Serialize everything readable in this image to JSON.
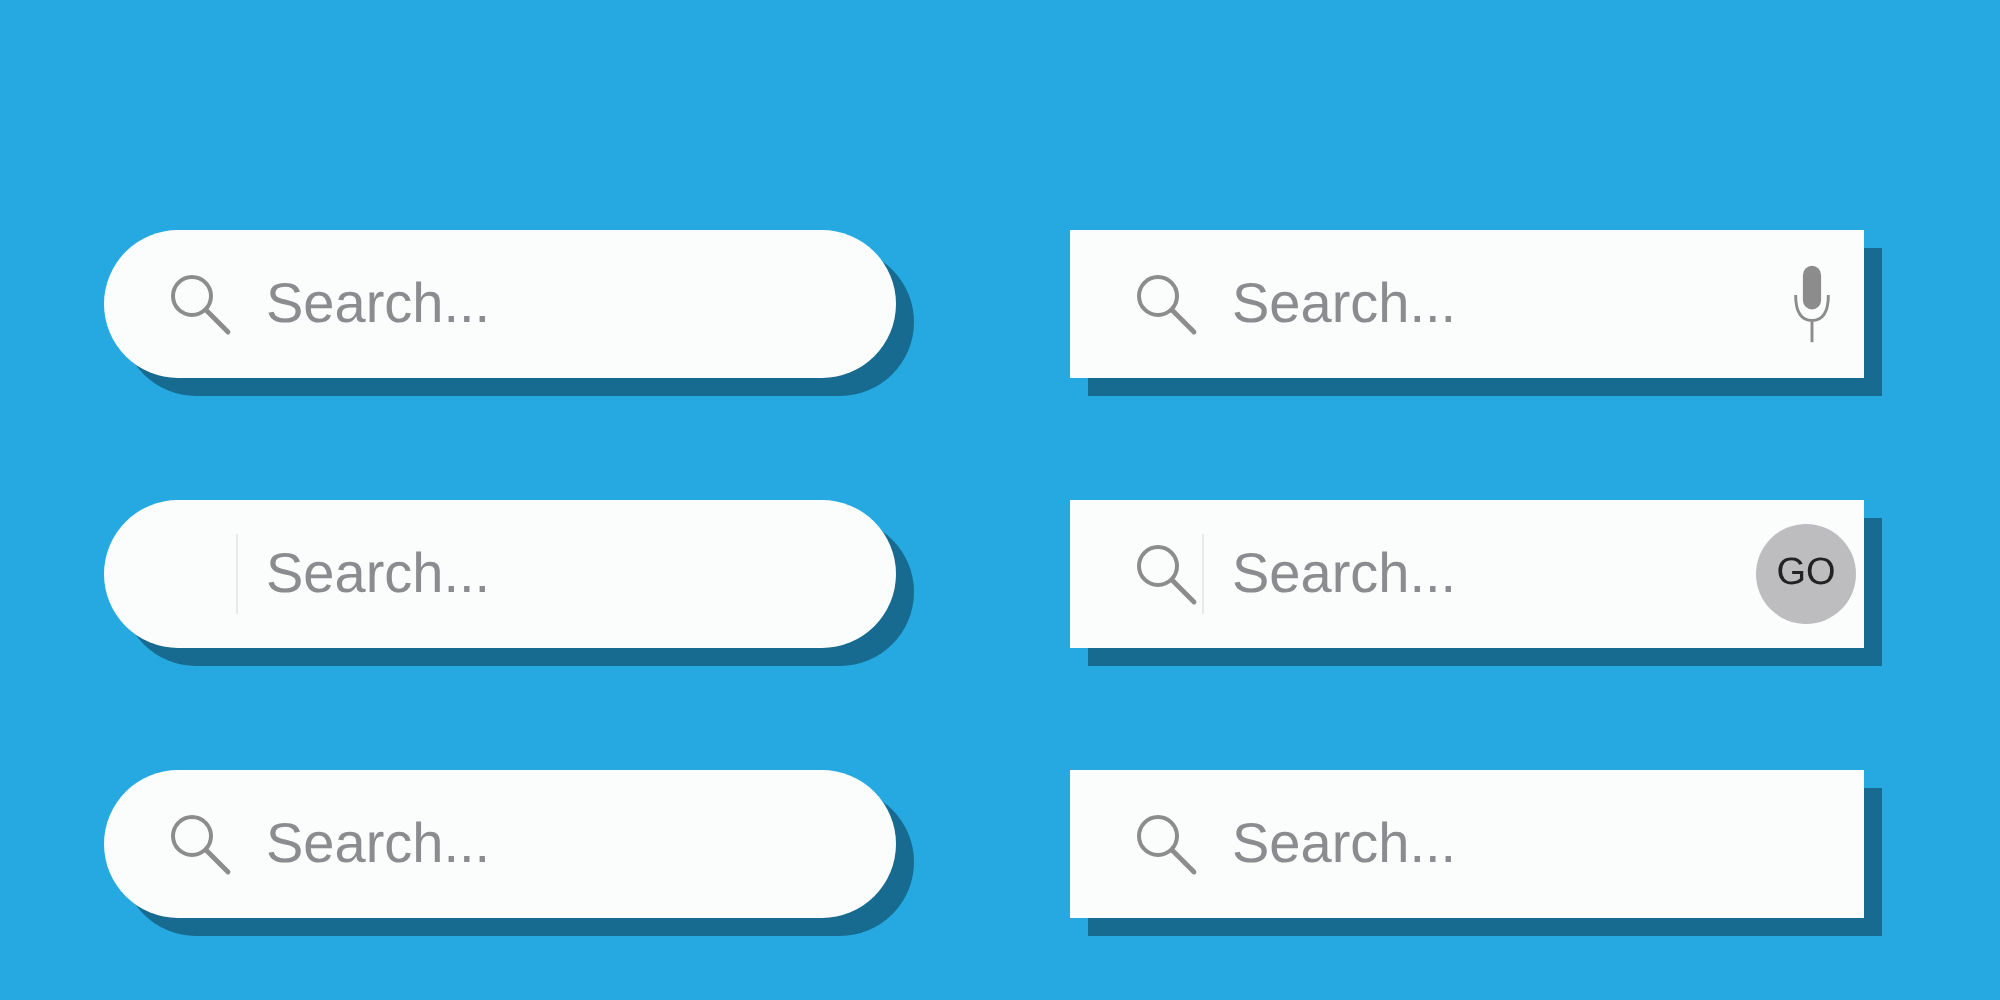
{
  "search_bars": [
    {
      "kind": "rounded",
      "search_icon": true,
      "divider": false,
      "placeholder": "Search..."
    },
    {
      "kind": "rounded",
      "search_icon": false,
      "divider": true,
      "placeholder": "Search..."
    },
    {
      "kind": "rounded",
      "search_icon": true,
      "divider": false,
      "placeholder": "Search..."
    },
    {
      "kind": "square",
      "search_icon": true,
      "divider": false,
      "placeholder": "Search...",
      "trailing": {
        "kind": "mic"
      }
    },
    {
      "kind": "square",
      "search_icon": true,
      "divider": true,
      "placeholder": "Search...",
      "trailing": {
        "kind": "button",
        "label": "GO"
      }
    },
    {
      "kind": "square",
      "search_icon": true,
      "divider": false,
      "placeholder": "Search..."
    }
  ]
}
